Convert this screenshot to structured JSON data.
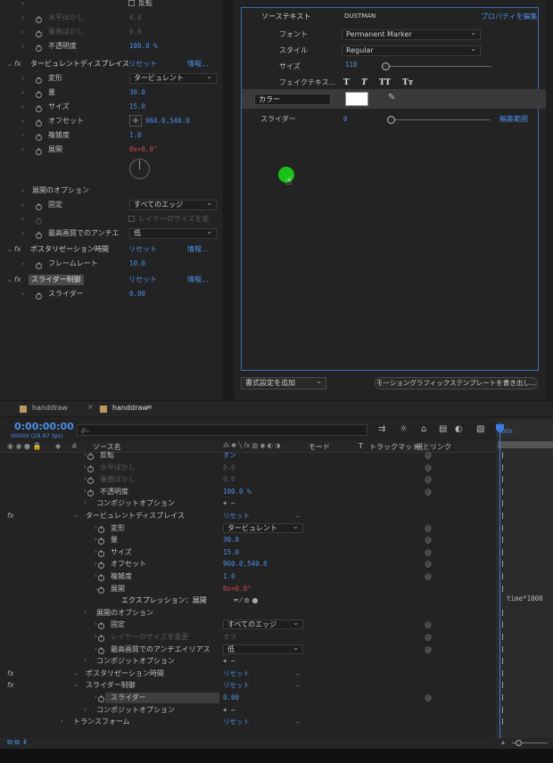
{
  "effects": {
    "rows": [
      {
        "label": "反転",
        "checkbox": true
      },
      {
        "label": "水平ぼかし",
        "value": "0.0",
        "dim": true
      },
      {
        "label": "垂直ぼかし",
        "value": "0.0",
        "dim": true
      },
      {
        "label": "不透明度",
        "value": "100.0 %"
      },
      {
        "label": "タービュレントディスプレイス",
        "reset": "リセット",
        "info": "情報..."
      },
      {
        "label": "変形",
        "value": "タービュレント"
      },
      {
        "label": "量",
        "value": "30.0"
      },
      {
        "label": "サイズ",
        "value": "15.0"
      },
      {
        "label": "オフセット",
        "value": "960.0,540.0"
      },
      {
        "label": "複雑度",
        "value": "1.0"
      },
      {
        "label": "展開",
        "value": "0x+0.0°"
      },
      {
        "label": "展開のオプション"
      },
      {
        "label": "固定",
        "value": "すべてのエッジ"
      },
      {
        "label": "レイヤーのサイズを変",
        "dim": true
      },
      {
        "label": "最高画質でのアンチエ",
        "value": "低"
      },
      {
        "label": "ポスタリゼーション時間",
        "reset": "リセット",
        "info": "情報..."
      },
      {
        "label": "フレームレート",
        "value": "10.0"
      },
      {
        "label": "スライダー制御",
        "reset": "リセット",
        "info": "情報..."
      },
      {
        "label": "スライダー",
        "value": "0.00"
      }
    ]
  },
  "eg": {
    "source_text_label": "ソーステキスト",
    "source_text_value": "DUSTMAN",
    "properties_link": "プロパティを編集",
    "font_label": "フォント",
    "font_value": "Permanent Marker",
    "style_label": "スタイル",
    "style_value": "Regular",
    "size_label": "サイズ",
    "size_value": "118",
    "faux_label": "フェイクテキス...",
    "faux_buttons": [
      "T",
      "T",
      "TT",
      "Tт"
    ],
    "color_label": "カラー",
    "color_value": "#ffffff",
    "slider_label": "スライダー",
    "slider_value": "0",
    "edit_range": "編集範囲",
    "add_format": "書式設定を追加",
    "export_button": "モーショングラフィックステンプレートを書き出し..."
  },
  "timeline": {
    "tabs": [
      "handdraw",
      "handdraw"
    ],
    "timecode": "0:00:00:00",
    "fps": "00000 (29.97 fps)",
    "search_placeholder": "ρ₊",
    "col_source": "ソース名",
    "col_mode": "モード",
    "col_t": "T",
    "col_trackmatte": "トラックマット",
    "col_parent": "親とリンク",
    "ruler_start": ":00s",
    "expression_text": "time*1000",
    "rows": [
      {
        "label": "反転",
        "value": "オン",
        "indent": 108,
        "dim": false
      },
      {
        "label": "水平ぼかし",
        "value": "0.0",
        "indent": 108,
        "dim": true
      },
      {
        "label": "垂直ぼかし",
        "value": "0.0",
        "indent": 108,
        "dim": true
      },
      {
        "label": "不透明度",
        "value": "100.0 %",
        "indent": 108,
        "dim": false
      },
      {
        "label": "コンポジットオプション",
        "value": "+ —",
        "indent": 108,
        "dim": false
      },
      {
        "label": "タービュレントディスプレイス",
        "value": "リセット",
        "indent": 96,
        "dim": false,
        "fx": true
      },
      {
        "label": "変形",
        "value": "タービュレント",
        "indent": 120,
        "dim": false,
        "dd": true
      },
      {
        "label": "量",
        "value": "30.0",
        "indent": 120,
        "dim": false
      },
      {
        "label": "サイズ",
        "value": "15.0",
        "indent": 120,
        "dim": false
      },
      {
        "label": "オフセット",
        "value": "960.0,540.0",
        "indent": 120,
        "dim": false
      },
      {
        "label": "複雑度",
        "value": "1.0",
        "indent": 120,
        "dim": false
      },
      {
        "label": "展開",
        "value": "0x+0.0°",
        "indent": 120,
        "dim": false,
        "red": true
      },
      {
        "label": "エクスプレッション：展開",
        "value": "",
        "indent": 136,
        "dim": false,
        "expr": true
      },
      {
        "label": "展開のオプション",
        "value": "",
        "indent": 108,
        "dim": false
      },
      {
        "label": "固定",
        "value": "すべてのエッジ",
        "indent": 120,
        "dim": false,
        "dd": true
      },
      {
        "label": "レイヤーのサイズを変更",
        "value": "オフ",
        "indent": 120,
        "dim": true
      },
      {
        "label": "最高画質でのアンチエイリアス",
        "value": "低",
        "indent": 120,
        "dim": false,
        "dd": true
      },
      {
        "label": "コンポジットオプション",
        "value": "+ —",
        "indent": 108,
        "dim": false
      },
      {
        "label": "ポスタリゼーション時間",
        "value": "リセット",
        "indent": 96,
        "dim": false,
        "fx": true
      },
      {
        "label": "スライダー制御",
        "value": "リセット",
        "indent": 96,
        "dim": false,
        "fx": true
      },
      {
        "label": "スライダー",
        "value": "0.00",
        "indent": 120,
        "dim": false,
        "selected": true
      },
      {
        "label": "コンポジットオプション",
        "value": "+ —",
        "indent": 108,
        "dim": false
      },
      {
        "label": "トランスフォーム",
        "value": "リセット",
        "indent": 82,
        "dim": false
      }
    ]
  }
}
